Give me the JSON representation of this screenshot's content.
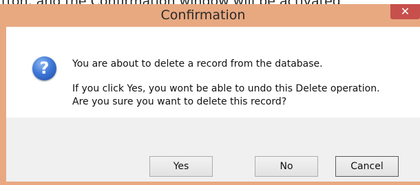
{
  "background": {
    "partial_text": "tton, and the Confirmation window will be activated"
  },
  "dialog": {
    "title": "Confirmation",
    "close_glyph": "✕",
    "icon": "question-icon",
    "icon_glyph": "?",
    "message_line1": "You are about to delete a record from the database.",
    "message_line2": "If you click Yes, you wont be able to undo this Delete operation.",
    "message_line3": "Are you sure you want to delete this record?",
    "buttons": {
      "yes": "Yes",
      "no": "No",
      "cancel": "Cancel"
    }
  },
  "colors": {
    "frame": "#e8a981",
    "close_button": "#c7504c",
    "message_area": "#ffffff",
    "button_bar": "#f0f0f0"
  }
}
